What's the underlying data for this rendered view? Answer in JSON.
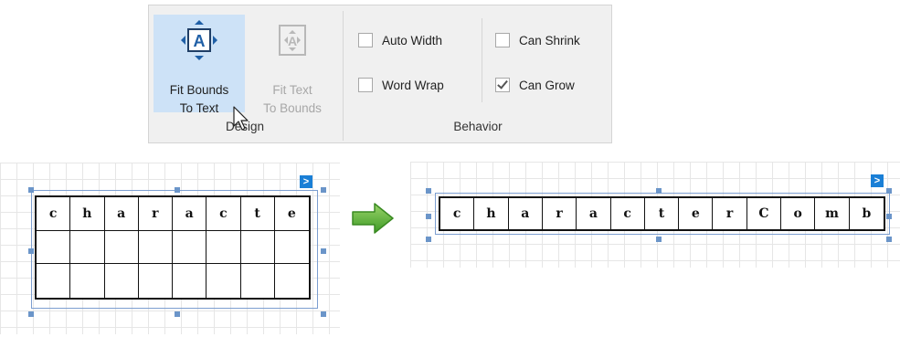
{
  "ribbon": {
    "fit_bounds_label": "Fit Bounds\nTo Text",
    "fit_text_label": "Fit Text\nTo Bounds",
    "design_caption": "Design",
    "behavior_caption": "Behavior",
    "auto_width_label": "Auto Width",
    "word_wrap_label": "Word Wrap",
    "can_shrink_label": "Can Shrink",
    "can_grow_label": "Can Grow",
    "auto_width_checked": false,
    "word_wrap_checked": false,
    "can_shrink_checked": false,
    "can_grow_checked": true
  },
  "before": {
    "chars": [
      "c",
      "h",
      "a",
      "r",
      "a",
      "c",
      "t",
      "e"
    ],
    "rows": 3,
    "smart_tag": ">"
  },
  "after": {
    "chars": [
      "c",
      "h",
      "a",
      "r",
      "a",
      "c",
      "t",
      "e",
      "r",
      "C",
      "o",
      "m",
      "b"
    ],
    "rows": 1,
    "smart_tag": ">"
  },
  "colors": {
    "accent": "#cde2f7",
    "handle": "#6b95c9",
    "arrow": "#5fb63a",
    "smart_tag": "#1a7fd6"
  },
  "icons": [
    "fit-bounds-to-text-icon",
    "fit-text-to-bounds-icon",
    "right-arrow-icon",
    "mouse-pointer-icon",
    "smart-tag-icon"
  ]
}
